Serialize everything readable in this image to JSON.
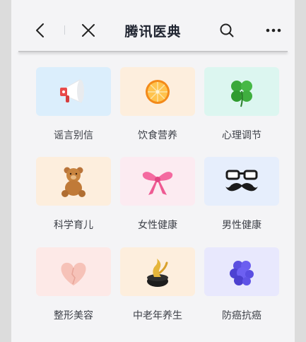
{
  "header": {
    "title": "腾讯医典",
    "back_icon": "chevron-left-icon",
    "close_icon": "close-icon",
    "search_icon": "search-icon",
    "more_icon": "more-horizontal-icon"
  },
  "categories": [
    {
      "label": "谣言别信",
      "icon": "megaphone-icon",
      "tile_color": "#dbeefc"
    },
    {
      "label": "饮食营养",
      "icon": "orange-slice-icon",
      "tile_color": "#fdeedd"
    },
    {
      "label": "心理调节",
      "icon": "clover-icon",
      "tile_color": "#dcf6f0"
    },
    {
      "label": "科学育儿",
      "icon": "teddy-bear-icon",
      "tile_color": "#fdeedd"
    },
    {
      "label": "女性健康",
      "icon": "bow-icon",
      "tile_color": "#fcebf1"
    },
    {
      "label": "男性健康",
      "icon": "glasses-mustache-icon",
      "tile_color": "#e6eefc"
    },
    {
      "label": "整形美容",
      "icon": "heart-icon",
      "tile_color": "#fde9e7"
    },
    {
      "label": "中老年养生",
      "icon": "gold-pot-icon",
      "tile_color": "#fdeedd"
    },
    {
      "label": "防癌抗癌",
      "icon": "purple-cluster-icon",
      "tile_color": "#e8e8fd"
    }
  ]
}
